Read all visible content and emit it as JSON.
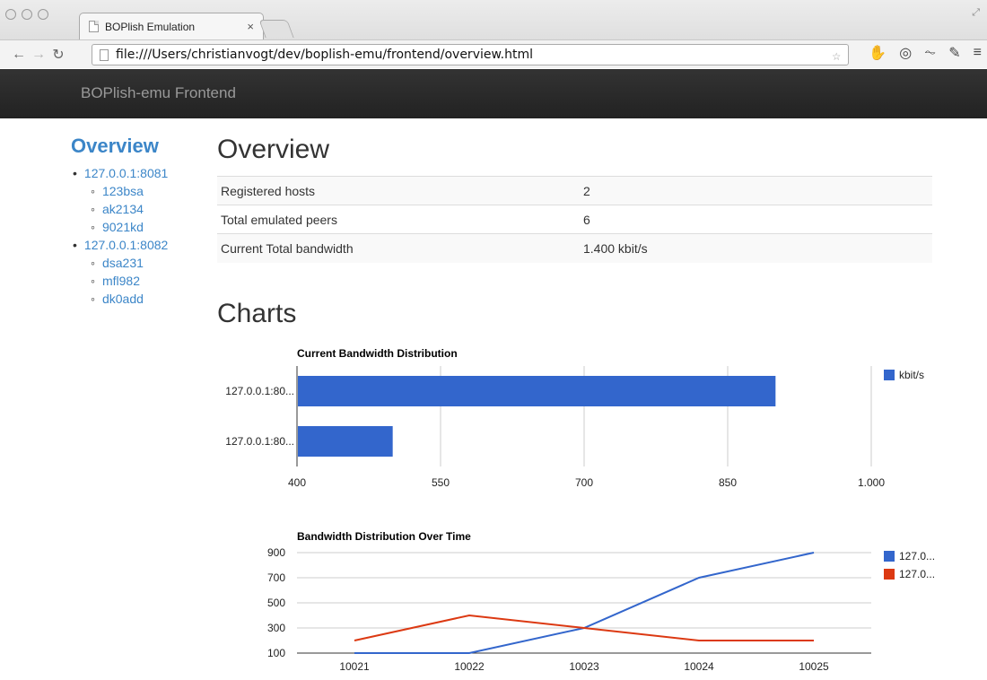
{
  "browser": {
    "tab_title": "BOPlish Emulation",
    "tab_close": "×",
    "url": "file:///Users/christianvogt/dev/boplish-emu/frontend/overview.html"
  },
  "navbar": {
    "brand": "BOPlish-emu Frontend"
  },
  "sidebar": {
    "title": "Overview",
    "hosts": [
      {
        "name": "127.0.0.1:8081",
        "peers": [
          "123bsa",
          "ak2134",
          "9021kd"
        ]
      },
      {
        "name": "127.0.0.1:8082",
        "peers": [
          "dsa231",
          "mfl982",
          "dk0add"
        ]
      }
    ]
  },
  "overview": {
    "title": "Overview",
    "rows": [
      {
        "label": "Registered hosts",
        "value": "2"
      },
      {
        "label": "Total emulated peers",
        "value": "6"
      },
      {
        "label": "Current Total bandwidth",
        "value": "1.400 kbit/s"
      }
    ]
  },
  "charts_title": "Charts",
  "chart_data": [
    {
      "type": "bar",
      "orientation": "horizontal",
      "title": "Current Bandwidth Distribution",
      "categories": [
        "127.0.0.1:80...",
        "127.0.0.1:80..."
      ],
      "series": [
        {
          "name": "kbit/s",
          "values": [
            900,
            500
          ],
          "color": "#3366cc"
        }
      ],
      "xlim": [
        400,
        1000
      ],
      "xticks": [
        "400",
        "550",
        "700",
        "850",
        "1.000"
      ],
      "xtick_values": [
        400,
        550,
        700,
        850,
        1000
      ],
      "legend": "right",
      "grid": true
    },
    {
      "type": "line",
      "title": "Bandwidth Distribution Over Time",
      "x": [
        "10021",
        "10022",
        "10023",
        "10024",
        "10025"
      ],
      "series": [
        {
          "name": "127.0...",
          "values": [
            100,
            100,
            300,
            700,
            900
          ],
          "color": "#3366cc"
        },
        {
          "name": "127.0...",
          "values": [
            200,
            400,
            300,
            200,
            200
          ],
          "color": "#dc3912"
        }
      ],
      "ylim": [
        100,
        900
      ],
      "yticks": [
        "900",
        "700",
        "500",
        "300",
        "100"
      ],
      "ytick_values": [
        900,
        700,
        500,
        300,
        100
      ],
      "legend": "right",
      "grid": true
    }
  ]
}
